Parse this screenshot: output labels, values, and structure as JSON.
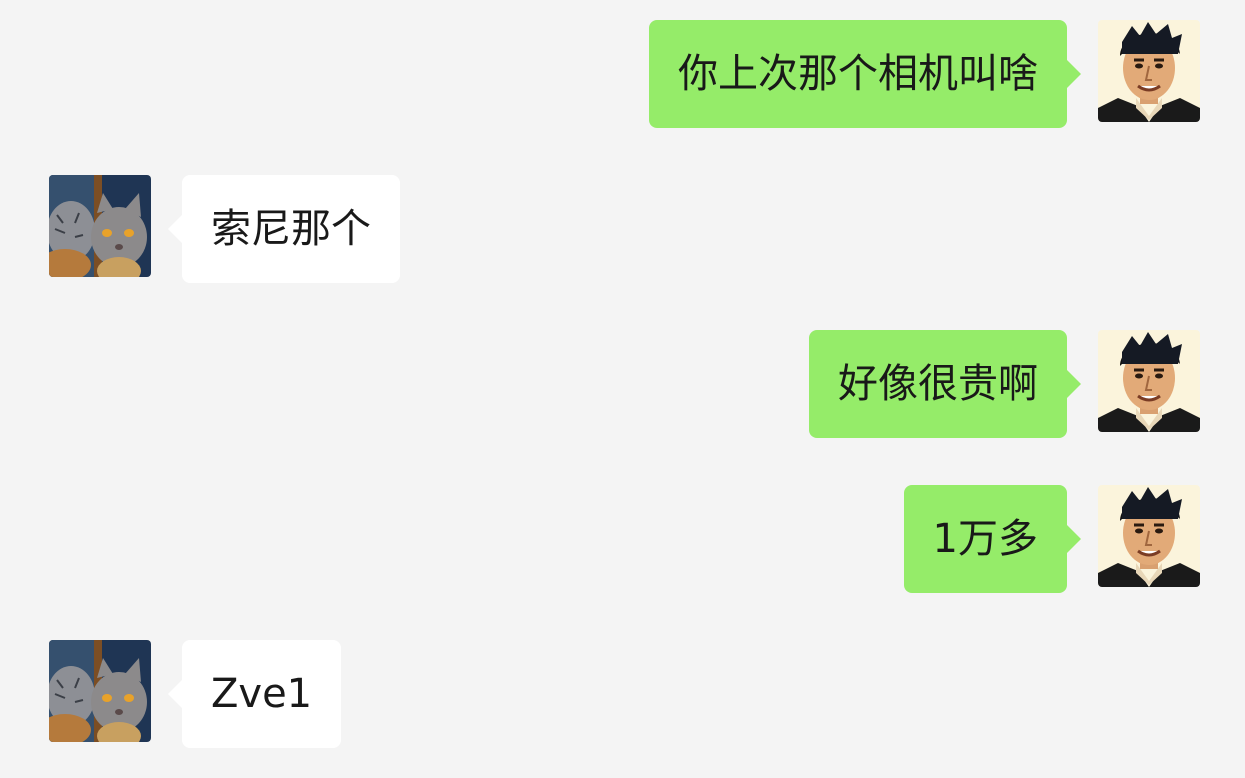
{
  "chat": {
    "messages": [
      {
        "side": "out",
        "text": "你上次那个相机叫啥",
        "avatar_icon": "man-portrait-icon"
      },
      {
        "side": "in",
        "text": "索尼那个",
        "avatar_icon": "cat-tiger-portrait-icon"
      },
      {
        "side": "out",
        "text": "好像很贵啊",
        "avatar_icon": "man-portrait-icon"
      },
      {
        "side": "out",
        "text": "1万多",
        "avatar_icon": "man-portrait-icon"
      },
      {
        "side": "in",
        "text": "Zve1",
        "avatar_icon": "cat-tiger-portrait-icon"
      }
    ]
  },
  "colors": {
    "background": "#f4f4f4",
    "outgoing_bubble": "#95ec69",
    "incoming_bubble": "#ffffff",
    "text": "#191919"
  }
}
